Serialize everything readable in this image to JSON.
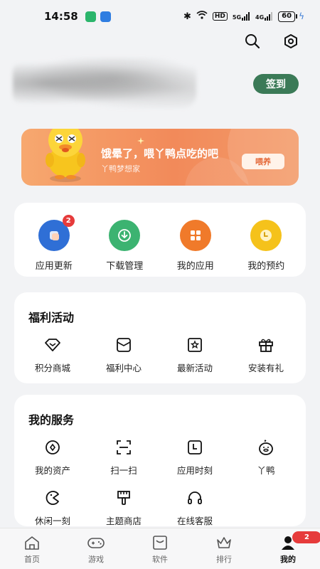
{
  "status_bar": {
    "time": "14:58",
    "hd_label": "HD",
    "signal_label": "5G",
    "signal2_label": "4G",
    "battery": "60"
  },
  "header": {
    "checkin_label": "签到"
  },
  "banner": {
    "title": "饿晕了，喂丫鸭点吃的吧",
    "subtitle": "丫鸭梦想家",
    "button_label": "喂养"
  },
  "quick_actions": [
    {
      "label": "应用更新",
      "icon": "app-update-icon",
      "color": "#2f6fd6",
      "badge": "2"
    },
    {
      "label": "下载管理",
      "icon": "download-icon",
      "color": "#3cb371",
      "badge": ""
    },
    {
      "label": "我的应用",
      "icon": "my-apps-icon",
      "color": "#f07a2a",
      "badge": ""
    },
    {
      "label": "我的预约",
      "icon": "reservation-icon",
      "color": "#f5c21b",
      "badge": ""
    }
  ],
  "welfare": {
    "title": "福利活动",
    "items": [
      {
        "label": "积分商城",
        "icon": "points-mall-icon"
      },
      {
        "label": "福利中心",
        "icon": "welfare-center-icon"
      },
      {
        "label": "最新活动",
        "icon": "latest-activity-icon"
      },
      {
        "label": "安装有礼",
        "icon": "gift-icon"
      }
    ]
  },
  "services": {
    "title": "我的服务",
    "items": [
      {
        "label": "我的资产",
        "icon": "assets-icon"
      },
      {
        "label": "扫一扫",
        "icon": "scan-icon"
      },
      {
        "label": "应用时刻",
        "icon": "app-time-icon"
      },
      {
        "label": "丫鸭",
        "icon": "duck-icon"
      },
      {
        "label": "休闲一刻",
        "icon": "leisure-icon"
      },
      {
        "label": "主题商店",
        "icon": "theme-store-icon"
      },
      {
        "label": "在线客服",
        "icon": "headset-icon"
      }
    ]
  },
  "bottom_nav": [
    {
      "label": "首页",
      "icon": "home-icon"
    },
    {
      "label": "游戏",
      "icon": "gamepad-icon"
    },
    {
      "label": "软件",
      "icon": "software-icon"
    },
    {
      "label": "排行",
      "icon": "crown-icon"
    },
    {
      "label": "我的",
      "icon": "profile-icon",
      "active": true,
      "badge": "2"
    }
  ]
}
